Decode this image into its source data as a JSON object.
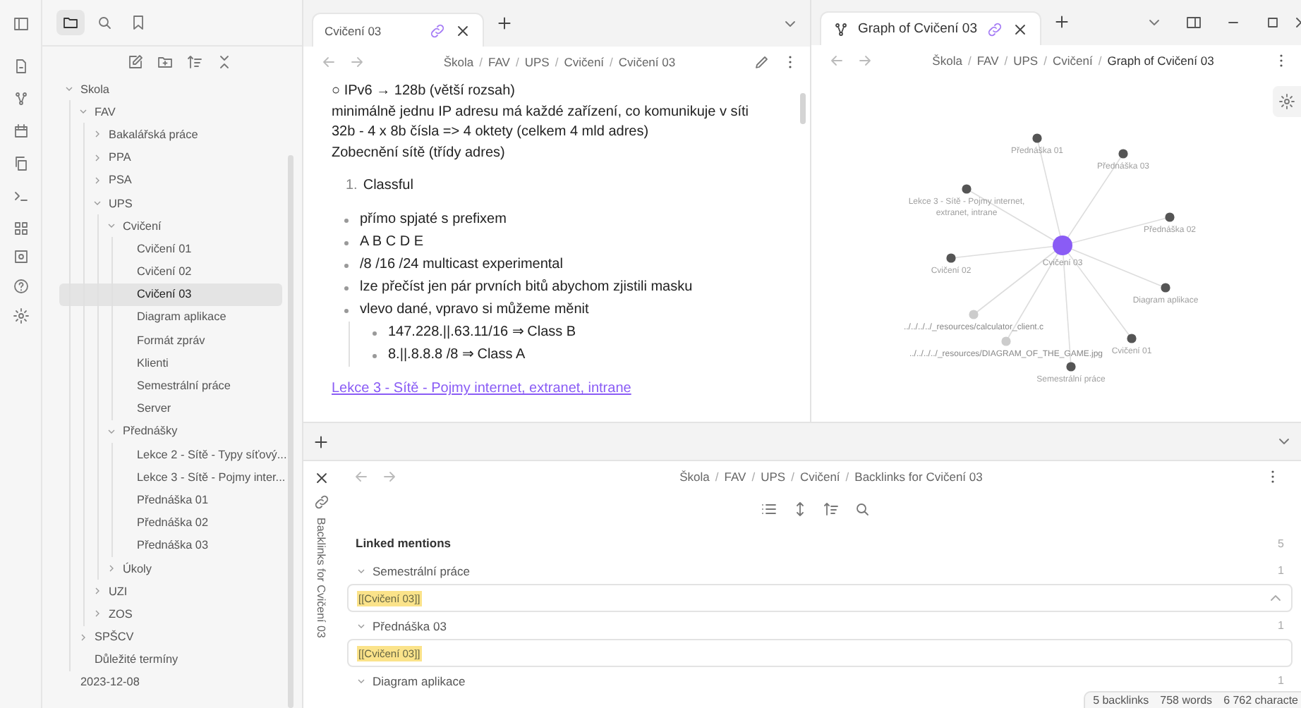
{
  "sidebar_tabs": [
    {
      "kind": "files",
      "selected": true
    },
    {
      "kind": "search",
      "selected": false
    },
    {
      "kind": "bookmarks",
      "selected": false
    }
  ],
  "file_tree": [
    {
      "name": "Skola",
      "kind": "folder",
      "expanded": true,
      "children": [
        {
          "name": "FAV",
          "kind": "folder",
          "expanded": true,
          "children": [
            {
              "name": "Bakalářská práce",
              "kind": "folder",
              "expanded": false
            },
            {
              "name": "PPA",
              "kind": "folder",
              "expanded": false
            },
            {
              "name": "PSA",
              "kind": "folder",
              "expanded": false
            },
            {
              "name": "UPS",
              "kind": "folder",
              "expanded": true,
              "children": [
                {
                  "name": "Cvičení",
                  "kind": "folder",
                  "expanded": true,
                  "children": [
                    {
                      "name": "Cvičení 01",
                      "kind": "file",
                      "selected": false
                    },
                    {
                      "name": "Cvičení 02",
                      "kind": "file",
                      "selected": false
                    },
                    {
                      "name": "Cvičení 03",
                      "kind": "file",
                      "selected": true
                    },
                    {
                      "name": "Diagram aplikace",
                      "kind": "file",
                      "selected": false
                    },
                    {
                      "name": "Formát zpráv",
                      "kind": "file",
                      "selected": false
                    },
                    {
                      "name": "Klienti",
                      "kind": "file",
                      "selected": false
                    },
                    {
                      "name": "Semestrální práce",
                      "kind": "file",
                      "selected": false
                    },
                    {
                      "name": "Server",
                      "kind": "file",
                      "selected": false
                    }
                  ]
                },
                {
                  "name": "Přednášky",
                  "kind": "folder",
                  "expanded": true,
                  "children": [
                    {
                      "name": "Lekce 2 - Sítě - Typy síťový...",
                      "kind": "file",
                      "selected": false
                    },
                    {
                      "name": "Lekce 3 - Sítě - Pojmy inter...",
                      "kind": "file",
                      "selected": false
                    },
                    {
                      "name": "Přednáška 01",
                      "kind": "file",
                      "selected": false
                    },
                    {
                      "name": "Přednáška 02",
                      "kind": "file",
                      "selected": false
                    },
                    {
                      "name": "Přednáška 03",
                      "kind": "file",
                      "selected": false
                    }
                  ]
                },
                {
                  "name": "Úkoly",
                  "kind": "folder",
                  "expanded": false
                }
              ]
            },
            {
              "name": "UZI",
              "kind": "folder",
              "expanded": false
            },
            {
              "name": "ZOS",
              "kind": "folder",
              "expanded": false
            }
          ]
        },
        {
          "name": "SPŠCV",
          "kind": "folder",
          "expanded": false
        },
        {
          "name": "Důležité termíny",
          "kind": "file",
          "selected": false
        }
      ]
    },
    {
      "name": "2023-12-08",
      "kind": "file",
      "selected": false
    }
  ],
  "editor": {
    "tab": {
      "title": "Cvičení 03"
    },
    "breadcrumb_separator": "/",
    "breadcrumb": [
      "Škola",
      "FAV",
      "UPS",
      "Cvičení",
      "Cvičení 03"
    ],
    "blocks": [
      {
        "kind": "line",
        "text": "○ IPv6 → 128b (větší rozsah)"
      },
      {
        "kind": "line",
        "text": "minimálně jednu IP adresu má každé zařízení, co komunikuje v síti"
      },
      {
        "kind": "line",
        "text": "32b - 4 x 8b čísla => 4 oktety (celkem 4 mld adres)"
      },
      {
        "kind": "line",
        "text": "Zobecnění sítě (třídy adres)"
      },
      {
        "kind": "ordered",
        "number": "1.",
        "text": "Classful"
      },
      {
        "kind": "bullet",
        "text": "přímo spjaté s prefixem"
      },
      {
        "kind": "bullet",
        "text": "A B C D E"
      },
      {
        "kind": "bullet",
        "text": "/8 /16 /24 multicast experimental"
      },
      {
        "kind": "bullet",
        "text": "lze přečíst jen pár prvních bitů abychom zjistili masku"
      },
      {
        "kind": "bullet",
        "text": "vlevo dané, vpravo si můžeme měnit",
        "children": [
          {
            "text": "147.228.||.63.11/16 ⇒ Class B"
          },
          {
            "text": "8.||.8.8.8 /8 ⇒ Class A"
          }
        ]
      },
      {
        "kind": "link",
        "text": "Lekce 3 - Sítě - Pojmy internet, extranet, intrane"
      }
    ]
  },
  "graph": {
    "tab": {
      "title": "Graph of Cvičení 03"
    },
    "breadcrumb_separator": "/",
    "breadcrumb": [
      "Škola",
      "FAV",
      "UPS",
      "Cvičení",
      "Graph of Cvičení 03"
    ],
    "nodes": [
      {
        "kind": "note",
        "label_lines": [
          "Přednáška 01"
        ]
      },
      {
        "kind": "note",
        "label_lines": [
          "Přednáška 03"
        ]
      },
      {
        "kind": "note",
        "label_lines": [
          "Lekce 3 - Sítě - Pojmy internet,",
          "extranet, intrane"
        ]
      },
      {
        "kind": "note",
        "label_lines": [
          "Přednáška 02"
        ]
      },
      {
        "kind": "current",
        "label_lines": [
          "Cvičení 03"
        ]
      },
      {
        "kind": "note",
        "label_lines": [
          "Cvičení 02"
        ]
      },
      {
        "kind": "note",
        "label_lines": [
          "Diagram aplikace"
        ]
      },
      {
        "kind": "unresolved",
        "label_lines": [
          "../../../../_resources/calculator_client.c"
        ]
      },
      {
        "kind": "note",
        "label_lines": [
          "Cvičení 01"
        ]
      },
      {
        "kind": "unresolved",
        "label_lines": [
          "../../../../_resources/DIAGRAM_OF_THE_GAME.jpg"
        ]
      },
      {
        "kind": "note",
        "label_lines": [
          "Semestrální práce"
        ]
      }
    ]
  },
  "backlinks": {
    "side_title": "Backlinks for Cvičení 03",
    "breadcrumb_separator": "/",
    "breadcrumb": [
      "Škola",
      "FAV",
      "UPS",
      "Cvičení",
      "Backlinks for Cvičení 03"
    ],
    "linked_mentions": {
      "title": "Linked mentions",
      "count": "5"
    },
    "groups": [
      {
        "title": "Semestrální práce",
        "count": "1",
        "expanded": true,
        "snippets": [
          "[[Cvičení 03]]"
        ]
      },
      {
        "title": "Přednáška 03",
        "count": "1",
        "expanded": true,
        "snippets": [
          "[[Cvičení 03]]"
        ]
      },
      {
        "title": "Diagram aplikace",
        "count": "1",
        "expanded": true
      }
    ]
  },
  "status_bar": [
    "5 backlinks",
    "758 words",
    "6 762 characte"
  ]
}
